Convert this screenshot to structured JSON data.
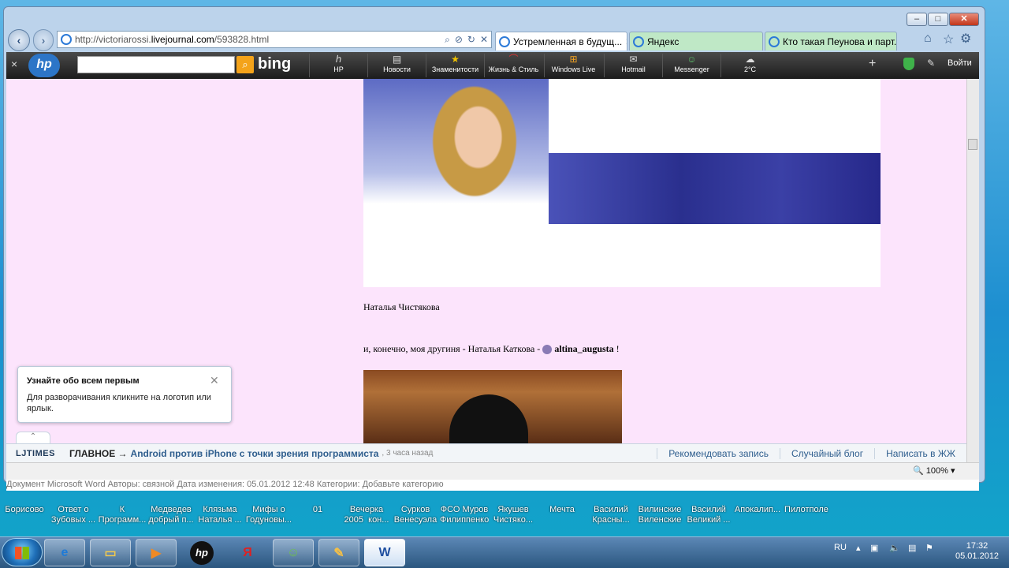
{
  "browser": {
    "url_prefix": "http://victoriarossi.",
    "url_domain": "livejournal.com",
    "url_suffix": "/593828.html",
    "tabs": [
      {
        "label": "Устремленная в будущ...",
        "active": true
      },
      {
        "label": "Яндекс",
        "active": false
      },
      {
        "label": "Кто такая Пеунова и парт...",
        "active": false
      }
    ]
  },
  "toolbar": {
    "close": "×",
    "logo": "hp",
    "search_brand": "bing",
    "items": [
      "HP",
      "Новости",
      "Знаменитости",
      "Жизнь & Стиль",
      "Windows Live",
      "Hotmail",
      "Messenger",
      "2°C"
    ],
    "add": "+",
    "login": "Войти"
  },
  "page": {
    "caption1": "Наталья Чистякова",
    "line2_prefix": "и, конечно, моя другиня - Наталья Каткова -",
    "user_link": "altina_augusta",
    "line2_suffix": "!"
  },
  "popup": {
    "title": "Узнайте обо всем первым",
    "text": "Для разворачивания кликните на логотип или ярлык.",
    "close": "✕"
  },
  "ljtimes": {
    "logo": "LJTIMES",
    "main": "ГЛАВНОЕ →",
    "link": "Android против iPhone с точки зрения программиста",
    "time": ", 3 часа назад",
    "actions": [
      "Рекомендовать запись",
      "Случайный блог",
      "Написать в ЖЖ"
    ]
  },
  "status": {
    "zoom": "100%"
  },
  "behind_window_text": "Документ Microsoft Word     Авторы:  связной                    Дата изменения: 05.01.2012 12:48                    Категории:  Добавьте категорию",
  "desktop_icons": [
    "Борисово",
    "Ответ о\nЗубовых ...",
    "К\nПрограмм...",
    "Медведев\nдобрый п...",
    "Клязьма\nНаталья ...",
    "Мифы о\nГодуновы...",
    "01",
    "Вечерка\n2005  кон...",
    "Сурков\nВенесуэла",
    "ФСО Муров\nФилиппенко",
    "Якушев\nЧистяко...",
    "Мечта",
    "Василий\nКрасны...",
    "Вилинские\nВиленские",
    "Василий\nВеликий ...",
    "Апокалип...",
    "Пилотполе"
  ],
  "taskbar": {
    "lang": "RU",
    "time": "17:32",
    "date": "05.01.2012"
  }
}
